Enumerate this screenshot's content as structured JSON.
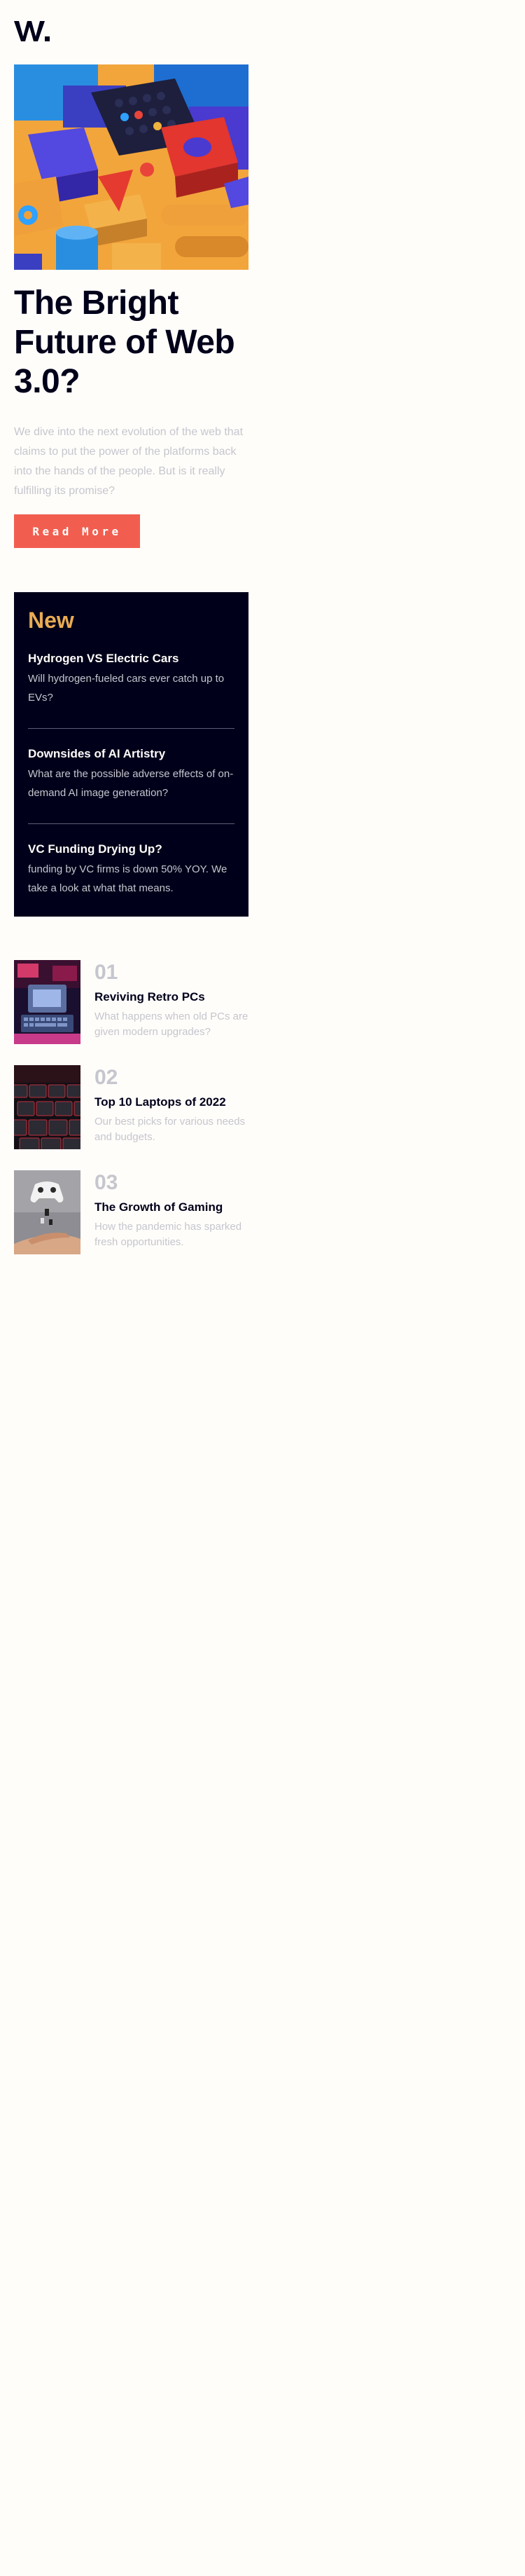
{
  "brand": {
    "logo_text": "W."
  },
  "hero": {
    "image_alt": "abstract-3d-blocks",
    "title": "The Bright Future of Web 3.0?",
    "description": "We dive into the next evolution of the web that claims to put the power of the platforms back into the hands of the people. But is it really fulfilling its promise?",
    "cta_label": "Read More"
  },
  "new_panel": {
    "heading": "New",
    "items": [
      {
        "title": "Hydrogen VS Electric Cars",
        "desc": "Will hydrogen-fueled cars ever catch up to EVs?"
      },
      {
        "title": "Downsides of AI Artistry",
        "desc": "What are the possible adverse effects of on-demand AI image generation?"
      },
      {
        "title": "VC Funding Drying Up?",
        "desc": "funding by VC firms is down 50% YOY. We take a look at what that means."
      }
    ]
  },
  "articles": [
    {
      "num": "01",
      "title": "Reviving Retro PCs",
      "desc": "What happens when old PCs are given modern upgrades?"
    },
    {
      "num": "02",
      "title": "Top 10 Laptops of 2022",
      "desc": "Our best picks for various needs and budgets."
    },
    {
      "num": "03",
      "title": "The Growth of Gaming",
      "desc": "How the pandemic has sparked fresh opportunities."
    }
  ],
  "colors": {
    "off_white": "#fffdfa",
    "dark_navy": "#00001a",
    "soft_red": "#f15e50",
    "soft_orange": "#e9ab53",
    "grayish_blue": "#5d5f79",
    "light_gray": "#c5c6ce"
  }
}
